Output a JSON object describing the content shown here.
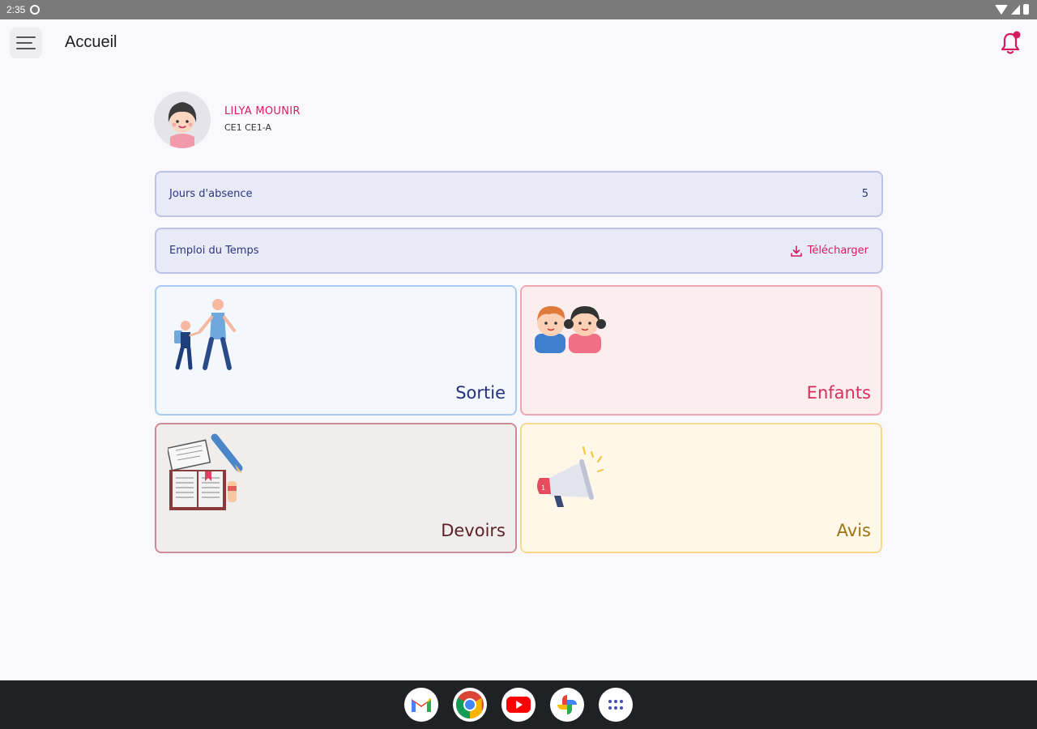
{
  "status_bar": {
    "time": "2:35"
  },
  "app_bar": {
    "title": "Accueil"
  },
  "profile": {
    "name": "LILYA MOUNIR",
    "class": "CE1 CE1-A"
  },
  "info": {
    "absence_label": "Jours d'absence",
    "absence_value": "5",
    "timetable_label": "Emploi  du Temps",
    "download_label": "Télécharger"
  },
  "tiles": [
    {
      "id": "sortie",
      "label": "Sortie",
      "icon": "walking-parent-child-icon"
    },
    {
      "id": "enfants",
      "label": "Enfants",
      "icon": "children-icon"
    },
    {
      "id": "devoirs",
      "label": "Devoirs",
      "icon": "homework-book-icon"
    },
    {
      "id": "avis",
      "label": "Avis",
      "icon": "megaphone-icon"
    }
  ],
  "dock": [
    "gmail-icon",
    "chrome-icon",
    "youtube-icon",
    "photos-icon",
    "app-drawer-icon"
  ],
  "colors": {
    "accent": "#d81b60",
    "primary": "#2d3584",
    "info_row_bg": "#e8eaf5"
  }
}
